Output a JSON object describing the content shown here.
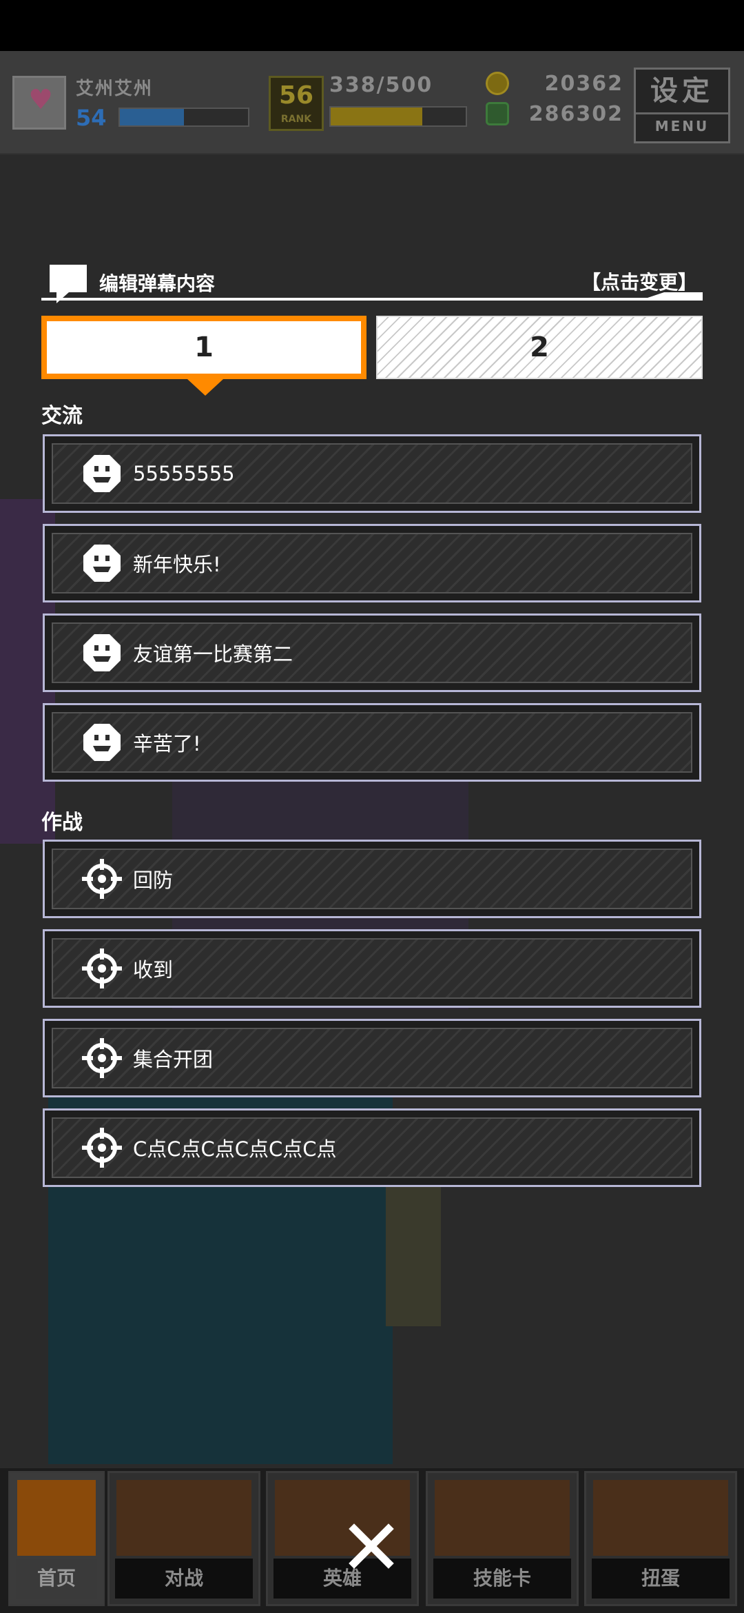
{
  "header": {
    "player_name": "艾州艾州",
    "level": "54",
    "exp_fraction": 0.5,
    "rank_badge_number": "56",
    "rank_badge_word": "RANK",
    "stamina": "338/500",
    "stamina_fraction": 0.68,
    "coins": "20362",
    "gems": "286302",
    "menu_title": "设定",
    "menu_sub": "MENU"
  },
  "editor": {
    "title": "编辑弹幕内容",
    "change_link": "【点击变更】",
    "tabs": [
      {
        "label": "1",
        "selected": true
      },
      {
        "label": "2",
        "selected": false
      }
    ],
    "sections": [
      {
        "label": "交流",
        "icon": "smiley-face-icon",
        "items": [
          "55555555",
          "新年快乐!",
          "友谊第一比赛第二",
          "辛苦了!"
        ]
      },
      {
        "label": "作战",
        "icon": "crosshair-icon",
        "items": [
          "回防",
          "收到",
          "集合开团",
          "C点C点C点C点C点C点"
        ]
      }
    ]
  },
  "bottom_nav": {
    "items": [
      {
        "label": "首页",
        "icon": "home-return-icon"
      },
      {
        "label": "对战",
        "icon": "gamepad-icon"
      },
      {
        "label": "英雄",
        "icon": "hero-icon"
      },
      {
        "label": "技能卡",
        "icon": "skill-card-icon"
      },
      {
        "label": "扭蛋",
        "icon": "gacha-icon"
      }
    ],
    "close_icon": "close-x-icon"
  },
  "colors": {
    "accent": "#ff8a00",
    "item_border": "#b7b7d6",
    "panel_text": "#ffffff"
  }
}
